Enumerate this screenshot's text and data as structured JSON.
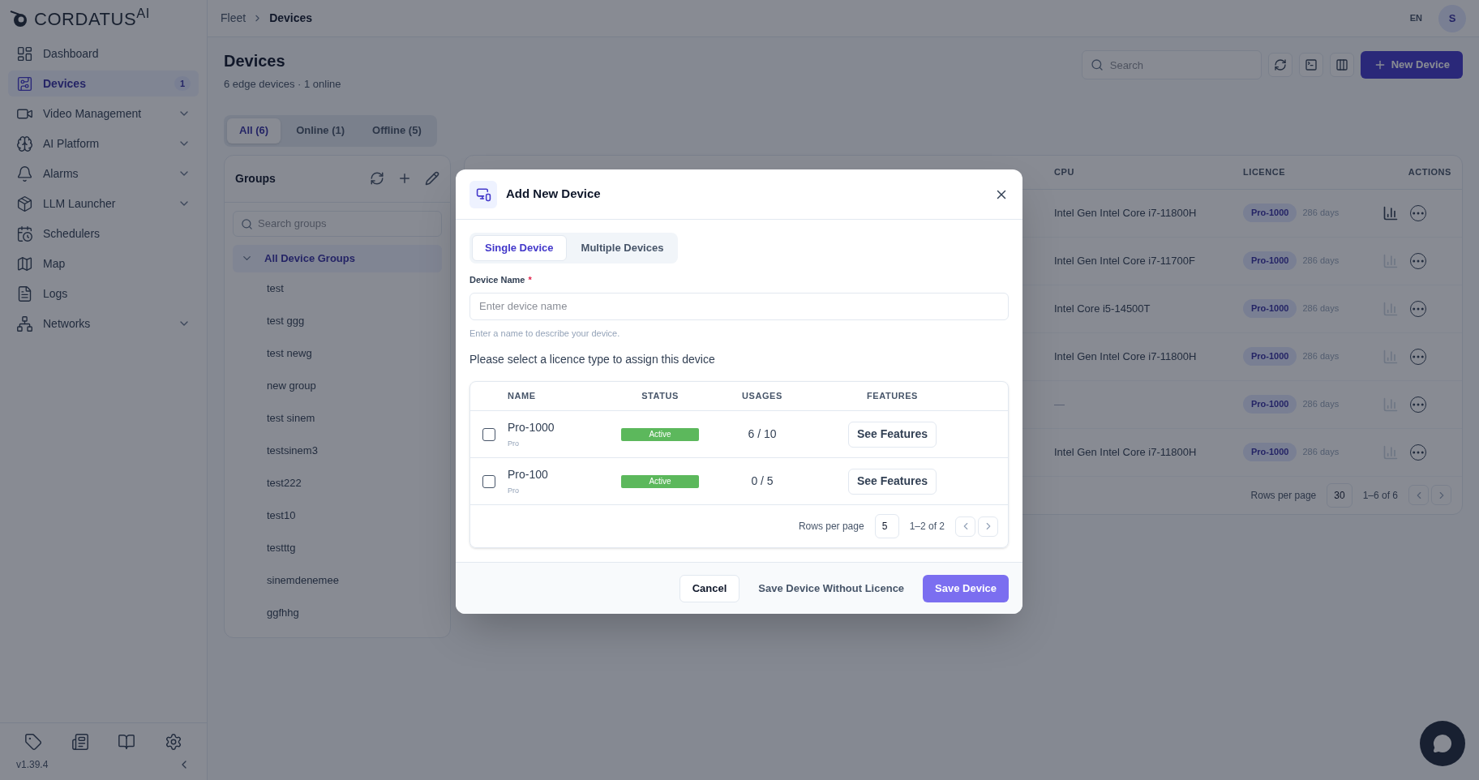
{
  "sidebar": {
    "logo": "CORDATUS$^{AI}$",
    "items": [
      {
        "label": "Dashboard",
        "selected": false,
        "expandable": false
      },
      {
        "label": "Devices",
        "selected": true,
        "expandable": false,
        "badge": "1"
      },
      {
        "label": "Video Management",
        "selected": false,
        "expandable": true
      },
      {
        "label": "AI Platform",
        "selected": false,
        "expandable": true
      },
      {
        "label": "Alarms",
        "selected": false,
        "expandable": true
      },
      {
        "label": "LLM Launcher",
        "selected": false,
        "expandable": true
      },
      {
        "label": "Schedulers",
        "selected": false,
        "expandable": false
      },
      {
        "label": "Map",
        "selected": false,
        "expandable": false
      },
      {
        "label": "Logs",
        "selected": false,
        "expandable": false
      },
      {
        "label": "Networks",
        "selected": false,
        "expandable": true
      }
    ],
    "version": "v1.39.4"
  },
  "breadcrumb": [
    "Fleet",
    "Devices"
  ],
  "header": {
    "language": "EN",
    "avatar": "S"
  },
  "page": {
    "title": "Devices",
    "subtitle": "6 edge devices · 1 online",
    "search_placeholder": "Search",
    "new_button": "New Device"
  },
  "filter_tabs": [
    {
      "label": "All (6)",
      "selected": true
    },
    {
      "label": "Online (1)",
      "selected": false
    },
    {
      "label": "Offline (5)",
      "selected": false
    }
  ],
  "groups": {
    "title": "Groups",
    "search_placeholder": "Search groups",
    "tree": {
      "label": "All Device Groups",
      "expanded": true,
      "children": [
        {
          "label": "test"
        },
        {
          "label": "test ggg"
        },
        {
          "label": "test newg"
        },
        {
          "label": "new group"
        },
        {
          "label": "test sinem"
        },
        {
          "label": "testsinem3"
        },
        {
          "label": "test222"
        },
        {
          "label": "test10"
        },
        {
          "label": "testttg"
        },
        {
          "label": "sinemdenemee"
        },
        {
          "label": "ggfhhg"
        }
      ]
    }
  },
  "devices_table": {
    "columns": [
      "CPU",
      "LICENCE",
      "ACTIONS"
    ],
    "rows": [
      {
        "cpu": "Intel Gen Intel Core i7-11800H",
        "licence": "Pro-1000",
        "remaining": "286 days",
        "stats_enabled": true
      },
      {
        "cpu": "Intel Gen Intel Core i7-11700F",
        "licence": "Pro-1000",
        "remaining": "286 days",
        "stats_enabled": false
      },
      {
        "cpu": "Intel Core i5-14500T",
        "licence": "Pro-1000",
        "remaining": "286 days",
        "stats_enabled": false
      },
      {
        "cpu": "Intel Gen Intel Core i7-11800H",
        "licence": "Pro-1000",
        "remaining": "286 days",
        "stats_enabled": false
      },
      {
        "cpu": "—",
        "licence": "Pro-1000",
        "remaining": "286 days",
        "stats_enabled": false
      },
      {
        "cpu": "Intel Gen Intel Core i7-11800H",
        "licence": "Pro-1000",
        "remaining": "286 days",
        "stats_enabled": false
      }
    ],
    "rows_per_page_label": "Rows per page",
    "rows_per_page": "30",
    "range": "1–6 of 6"
  },
  "modal": {
    "title": "Add New Device",
    "tabs": [
      {
        "label": "Single Device",
        "selected": true
      },
      {
        "label": "Multiple Devices",
        "selected": false
      }
    ],
    "field": {
      "label": "Device Name",
      "required": true,
      "required_mark": "*",
      "placeholder": "Enter device name",
      "helper": "Enter a name to describe your device."
    },
    "prompt": "Please select a licence type to assign this device",
    "licence_table": {
      "columns": [
        "NAME",
        "STATUS",
        "USAGES",
        "FEATURES"
      ],
      "rows": [
        {
          "name": "Pro-1000",
          "tier": "Pro",
          "status": "Active",
          "usages": "6 / 10",
          "action": "See Features",
          "checked": false
        },
        {
          "name": "Pro-100",
          "tier": "Pro",
          "status": "Active",
          "usages": "0 / 5",
          "action": "See Features",
          "checked": false
        }
      ],
      "rows_per_page_label": "Rows per page",
      "rows_per_page": "5",
      "range": "1–2 of 2"
    },
    "buttons": [
      {
        "label": "Cancel",
        "kind": "outline"
      },
      {
        "label": "Save Device Without Licence",
        "kind": "ghost"
      },
      {
        "label": "Save Device",
        "kind": "primary"
      }
    ]
  }
}
